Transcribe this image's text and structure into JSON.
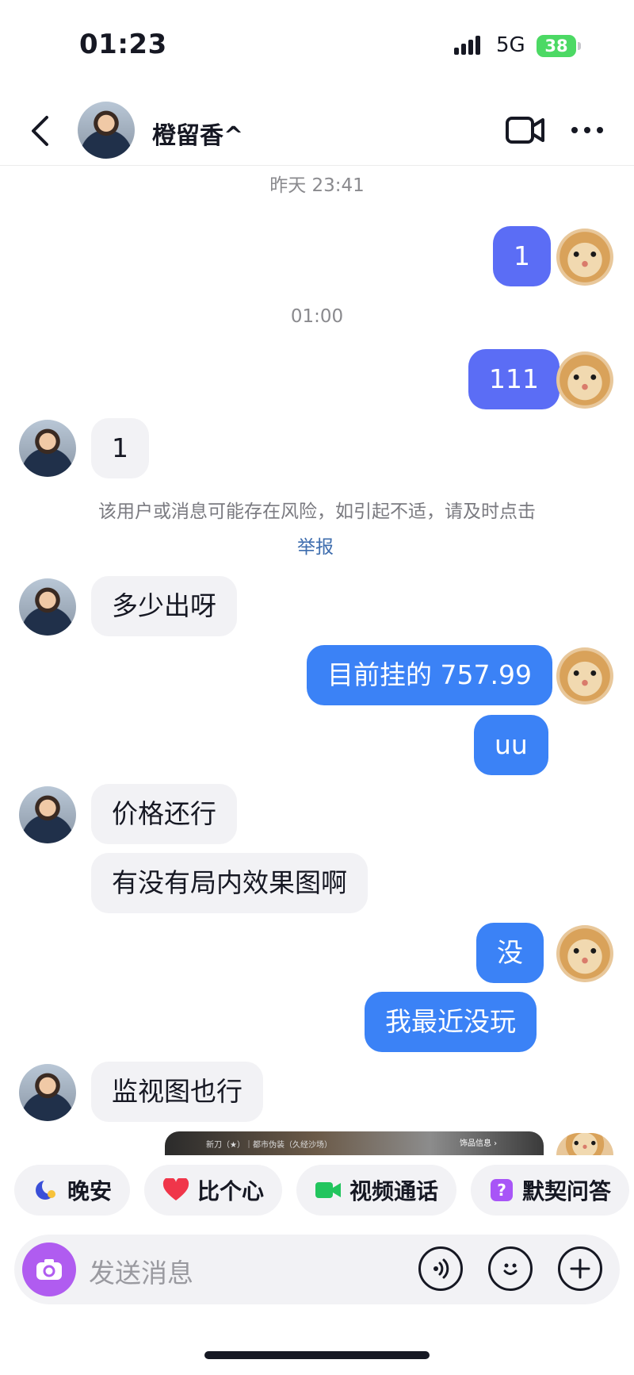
{
  "status_bar": {
    "time": "01:23",
    "network": "5G",
    "battery": "38"
  },
  "header": {
    "contact_name": "橙留香^"
  },
  "chat": {
    "timestamp_1": "昨天 23:41",
    "msg_out_1": "1",
    "timestamp_2": "01:00",
    "msg_out_2": "111",
    "msg_in_1": "1",
    "risk_warning": "该用户或消息可能存在风险，如引起不适，请及时点击",
    "report_link": "举报",
    "msg_in_2": "多少出呀",
    "msg_out_3": "目前挂的 757.99",
    "msg_out_4": "uu",
    "msg_in_3": "价格还行",
    "msg_in_4": "有没有局内效果图啊",
    "msg_out_5": "没",
    "msg_out_6": "我最近没玩",
    "msg_in_5": "监视图也行",
    "preview_caption": "新刀（★）｜都市伪装（久经沙场）",
    "preview_tag": "饰品信息 ›"
  },
  "quick_actions": [
    {
      "label": "晚安",
      "icon": "moon-icon"
    },
    {
      "label": "比个心",
      "icon": "heart-icon"
    },
    {
      "label": "视频通话",
      "icon": "video-call-icon"
    },
    {
      "label": "默契问答",
      "icon": "question-icon"
    }
  ],
  "input": {
    "placeholder": "发送消息"
  },
  "colors": {
    "outgoing_bubble": "#3b82f6",
    "incoming_bubble": "#f2f2f5",
    "camera_button": "#b05cf0",
    "battery": "#4cd964"
  }
}
